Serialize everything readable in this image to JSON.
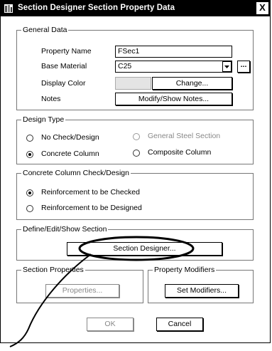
{
  "window": {
    "title": "Section Designer Section Property Data",
    "close_label": "X"
  },
  "general_data": {
    "legend": "General Data",
    "property_name_label": "Property Name",
    "property_name_value": "FSec1",
    "base_material_label": "Base Material",
    "base_material_value": "C25",
    "browse_label": "...",
    "display_color_label": "Display Color",
    "display_color_swatch": "#e4e4e4",
    "change_label": "Change...",
    "notes_label": "Notes",
    "modify_notes_label": "Modify/Show Notes..."
  },
  "design_type": {
    "legend": "Design Type",
    "options": [
      {
        "label": "No Check/Design",
        "checked": false,
        "enabled": true
      },
      {
        "label": "General Steel Section",
        "checked": false,
        "enabled": false
      },
      {
        "label": "Concrete Column",
        "checked": true,
        "enabled": true
      },
      {
        "label": "Composite Column",
        "checked": false,
        "enabled": true
      }
    ]
  },
  "concrete_check": {
    "legend": "Concrete Column Check/Design",
    "options": [
      {
        "label": "Reinforcement to be Checked",
        "checked": true
      },
      {
        "label": "Reinforcement to be Designed",
        "checked": false
      }
    ]
  },
  "define_section": {
    "legend": "Define/Edit/Show Section",
    "section_designer_label": "Section Designer..."
  },
  "section_properties": {
    "legend": "Section Properties",
    "properties_label": "Properties..."
  },
  "property_modifiers": {
    "legend": "Property Modifiers",
    "set_modifiers_label": "Set Modifiers..."
  },
  "footer": {
    "ok_label": "OK",
    "cancel_label": "Cancel"
  }
}
